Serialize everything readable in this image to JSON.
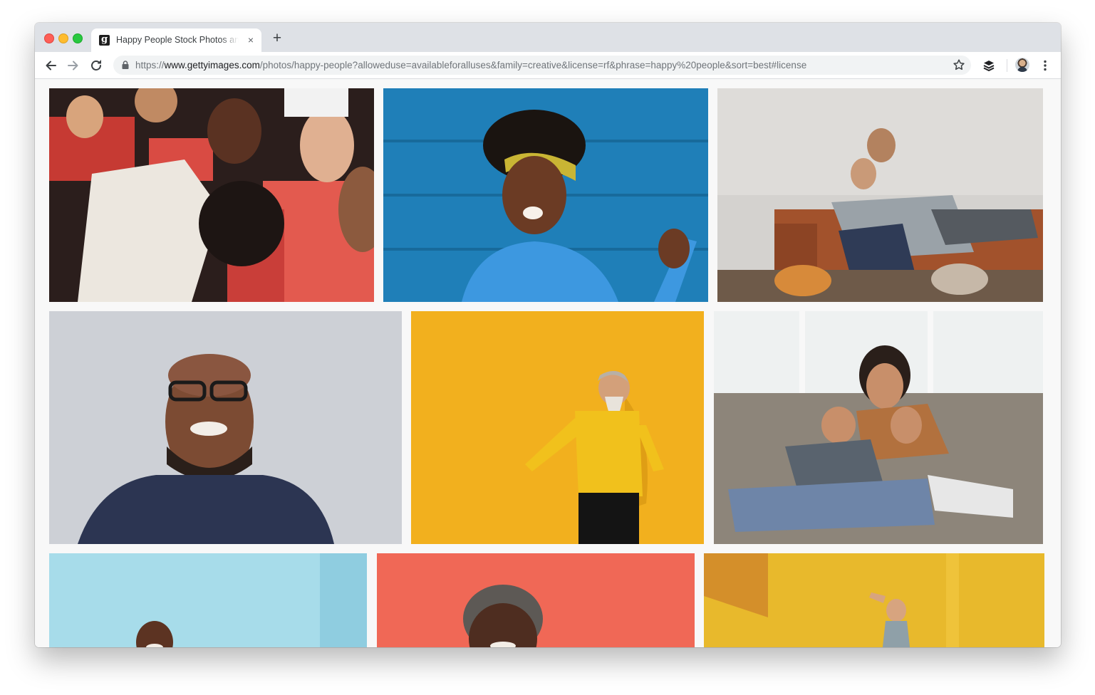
{
  "browser": {
    "tab": {
      "favicon_letter": "g",
      "title": "Happy People Stock Photos and Pictures | Getty Images"
    },
    "address": {
      "scheme": "https://",
      "host": "www.gettyimages.com",
      "path": "/photos/happy-people?alloweduse=availableforalluses&family=creative&license=rf&phrase=happy%20people&sort=best#license"
    },
    "icons": {
      "close_tab": "×",
      "new_tab": "+"
    }
  },
  "colors": {
    "tabbar": "#dee1e6",
    "omnibox": "#f1f3f4",
    "page_background": "#f8f8f8"
  },
  "gallery": {
    "photos": [
      {
        "id": "crowd-cheering",
        "dominant_color": "#b3322c"
      },
      {
        "id": "woman-blue-wall",
        "dominant_color": "#1f7fb8"
      },
      {
        "id": "couple-on-sofa",
        "dominant_color": "#c9c7c3"
      },
      {
        "id": "man-glasses-laughing",
        "dominant_color": "#cdd0d6"
      },
      {
        "id": "old-man-yellow-dancing",
        "dominant_color": "#f2b01e"
      },
      {
        "id": "mother-children-sofa",
        "dominant_color": "#a9a49b"
      },
      {
        "id": "man-light-blue",
        "dominant_color": "#a7dcea"
      },
      {
        "id": "woman-coral",
        "dominant_color": "#f06856"
      },
      {
        "id": "girl-yellow-jumping",
        "dominant_color": "#e8b92c"
      }
    ]
  }
}
